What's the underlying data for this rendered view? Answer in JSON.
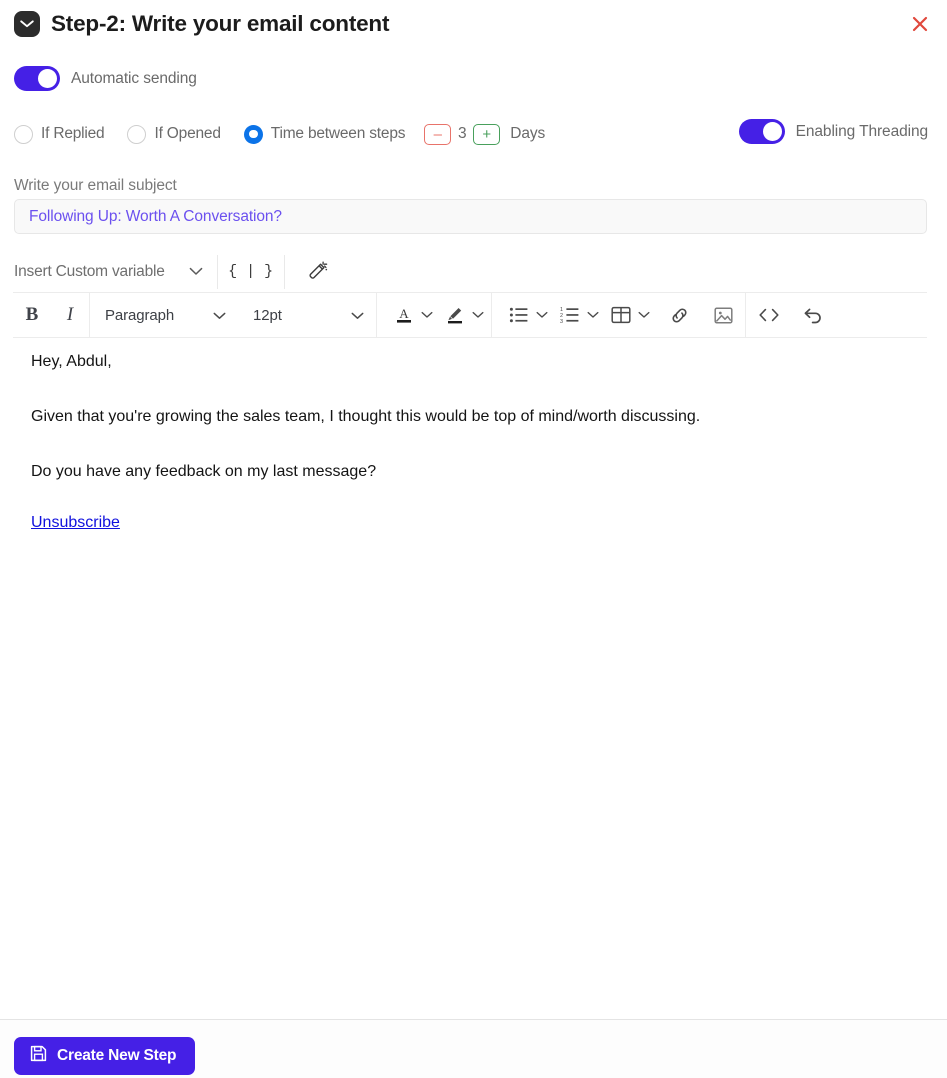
{
  "header": {
    "icon": "mail-icon",
    "step_prefix": "Step-2:",
    "title": "Write your email content",
    "close_icon": "close-icon",
    "close_color": "#e0483c"
  },
  "automatic_sending": {
    "label": "Automatic sending",
    "enabled": true,
    "accent": "#4520e6"
  },
  "conditions": {
    "options": [
      {
        "label": "If Replied",
        "selected": false
      },
      {
        "label": "If Opened",
        "selected": false
      },
      {
        "label": "Time between steps",
        "selected": true
      }
    ],
    "selected_accent": "#0b73e8",
    "stepper": {
      "decrement_label": "–",
      "value": "3",
      "increment_label": "+",
      "unit_label": "Days",
      "decrement_color": "#e8736a",
      "increment_color": "#49a05c"
    },
    "threading": {
      "label": "Enabling Threading",
      "enabled": true,
      "accent": "#4520e6"
    }
  },
  "subject": {
    "label": "Write your email subject",
    "value": "Following Up: Worth A Conversation?",
    "placeholder": "Write your email subject",
    "text_color": "#6b50ef"
  },
  "variable_bar": {
    "select_label": "Insert Custom variable",
    "chevron_icon": "chevron-down-icon",
    "braces_label": "{ | }",
    "braces_icon": "curly-braces-icon",
    "wand_icon": "magic-wand-icon"
  },
  "editor_toolbar": {
    "bold_label": "B",
    "italic_label": "I",
    "block_format": "Paragraph",
    "font_size": "12pt",
    "icons": [
      "text-color-icon",
      "text-color-caret-icon",
      "highlight-color-icon",
      "highlight-color-caret-icon",
      "bullet-list-icon",
      "bullet-list-caret-icon",
      "numbered-list-icon",
      "numbered-list-caret-icon",
      "table-icon",
      "table-caret-icon",
      "link-icon",
      "image-icon",
      "code-icon",
      "undo-icon"
    ]
  },
  "email_body": {
    "greeting": "Hey, Abdul,",
    "paragraph_1": "Given that you're growing the sales team, I thought this would be top of mind/worth discussing.",
    "paragraph_2": "Do you have any feedback on my last message?",
    "unsubscribe_label": "Unsubscribe",
    "link_color": "#1111dd"
  },
  "footer": {
    "create_button_label": "Create New Step",
    "create_button_icon": "save-icon",
    "create_button_color": "#4520e6"
  }
}
